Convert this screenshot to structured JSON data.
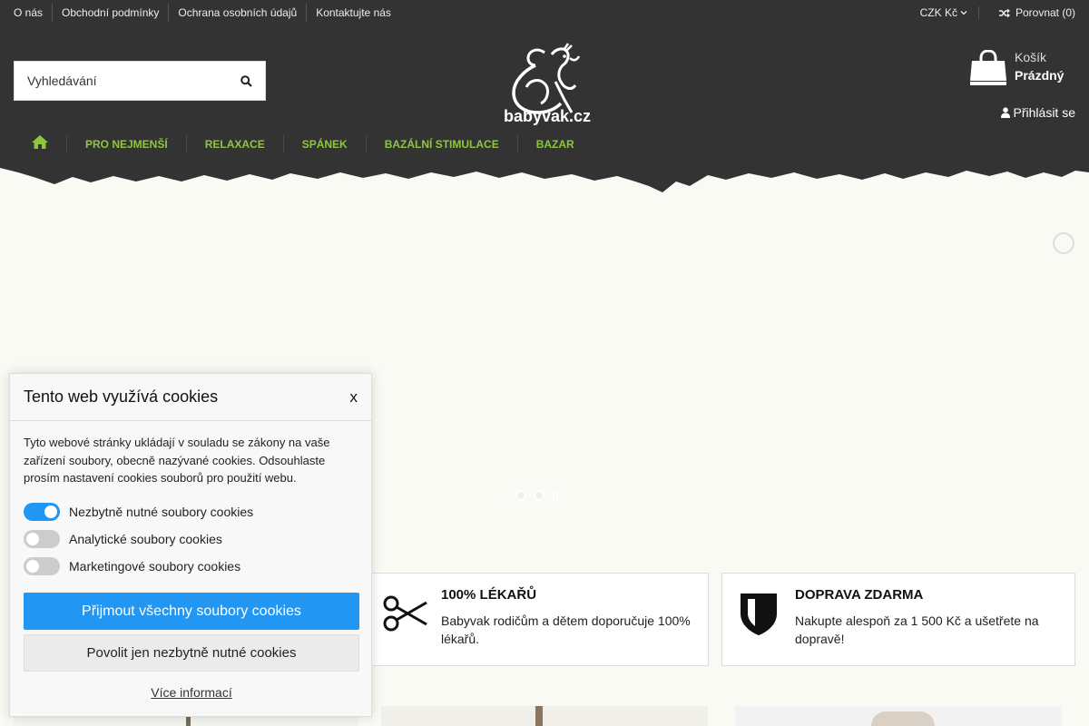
{
  "top_links": [
    "O nás",
    "Obchodní podmínky",
    "Ochrana osobních údajů",
    "Kontaktujte nás"
  ],
  "currency": {
    "label": "CZK Kč"
  },
  "compare": {
    "label": "Porovnat (0)"
  },
  "search": {
    "placeholder": "Vyhledávání"
  },
  "logo": {
    "text": "babyvak.cz"
  },
  "cart": {
    "label": "Košík",
    "status": "Prázdný"
  },
  "login": {
    "label": "Přihlásit se"
  },
  "nav": {
    "items": [
      "PRO NEJMENŠÍ",
      "RELAXACE",
      "SPÁNEK",
      "BAZÁLNÍ STIMULACE",
      "BAZAR"
    ]
  },
  "features": [
    {
      "title": "100% LÉKAŘŮ",
      "text": "Babyvak rodičům a dětem doporučuje 100% lékařů.",
      "icon": "scissors-icon"
    },
    {
      "title": "DOPRAVA ZDARMA",
      "text": "Nakupte alespoň za 1 500 Kč a ušetřete na dopravě!",
      "icon": "shield-icon"
    }
  ],
  "cookie": {
    "title": "Tento web využívá cookies",
    "close": "x",
    "description": "Tyto webové stránky ukládají v souladu se zákony na vaše zařízení soubory, obecně nazývané cookies. Odsouhlaste prosím nastavení cookies souborů pro použití webu.",
    "toggles": [
      {
        "label": "Nezbytně nutné soubory cookies",
        "state": "on"
      },
      {
        "label": "Analytické soubory cookies",
        "state": "off"
      },
      {
        "label": "Marketingové soubory cookies",
        "state": "off"
      }
    ],
    "accept_all": "Přijmout všechny soubory cookies",
    "only_necessary": "Povolit jen nezbytně nutné cookies",
    "more_info": "Více informací"
  },
  "colors": {
    "header_bg": "#333333",
    "nav_accent": "#8fc63f",
    "cookie_primary": "#2196f3"
  }
}
